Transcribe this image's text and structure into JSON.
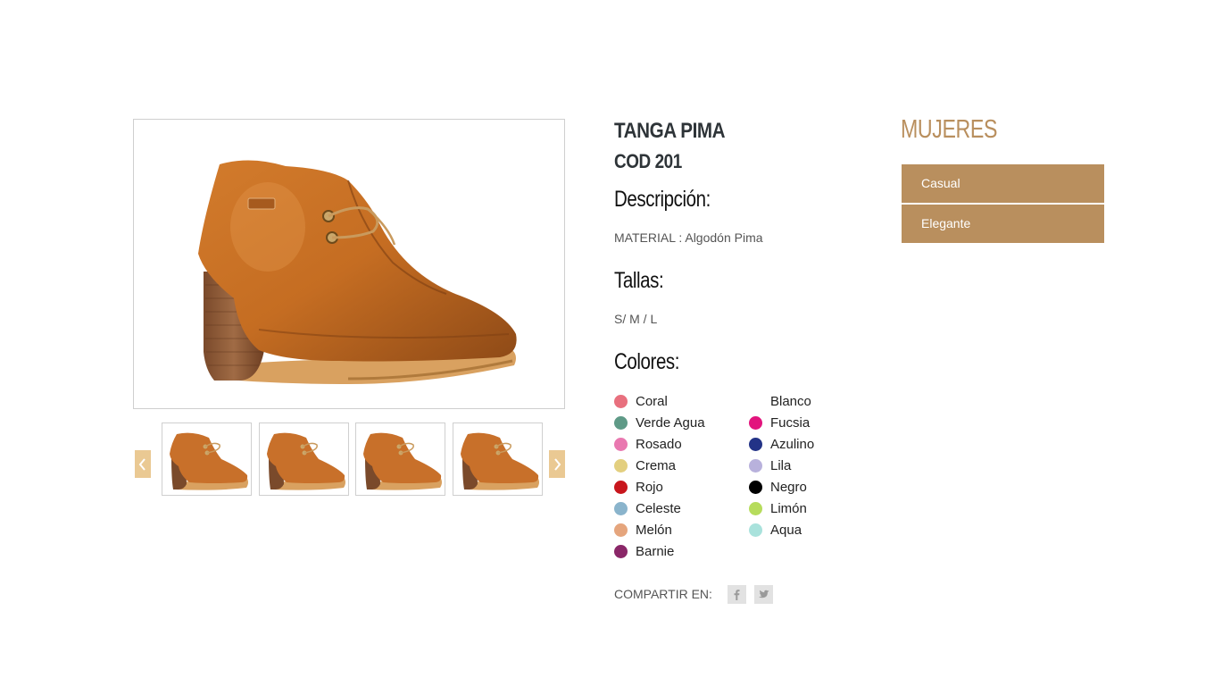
{
  "product": {
    "title": "TANGA PIMA",
    "code": "COD 201",
    "image_alt": "Brown leather lace-up ankle boot with stacked heel"
  },
  "gallery": {
    "prev_icon": "chevron-left-icon",
    "next_icon": "chevron-right-icon",
    "thumbnail_count": 4,
    "arrow_color": "#eac993"
  },
  "description": {
    "heading": "Descripción:",
    "text": "MATERIAL : Algodón Pima"
  },
  "sizes": {
    "heading": "Tallas:",
    "text": "S/ M / L"
  },
  "colors": {
    "heading": "Colores:",
    "left": [
      {
        "name": "Coral",
        "hex": "#e8707e"
      },
      {
        "name": "Verde Agua",
        "hex": "#5f9a87"
      },
      {
        "name": "Rosado",
        "hex": "#e978b0"
      },
      {
        "name": "Crema",
        "hex": "#e3cf7f"
      },
      {
        "name": "Rojo",
        "hex": "#c8161d"
      },
      {
        "name": "Celeste",
        "hex": "#8ab4cc"
      },
      {
        "name": "Melón",
        "hex": "#e5a57d"
      },
      {
        "name": "Barnie",
        "hex": "#8a2768"
      }
    ],
    "right": [
      {
        "name": "Blanco",
        "hex": "#ffffff"
      },
      {
        "name": "Fucsia",
        "hex": "#e2147d"
      },
      {
        "name": "Azulino",
        "hex": "#233387"
      },
      {
        "name": "Lila",
        "hex": "#b8b1dc"
      },
      {
        "name": "Negro",
        "hex": "#000000"
      },
      {
        "name": "Limón",
        "hex": "#b6dc5c"
      },
      {
        "name": "Aqua",
        "hex": "#a9e2dc"
      }
    ]
  },
  "share": {
    "label": "COMPARTIR EN:",
    "icons": [
      "facebook-icon",
      "twitter-icon"
    ]
  },
  "sidebar": {
    "title": "MUJERES",
    "items": [
      {
        "label": "Casual"
      },
      {
        "label": "Elegante"
      }
    ],
    "accent": "#b98f5e"
  }
}
